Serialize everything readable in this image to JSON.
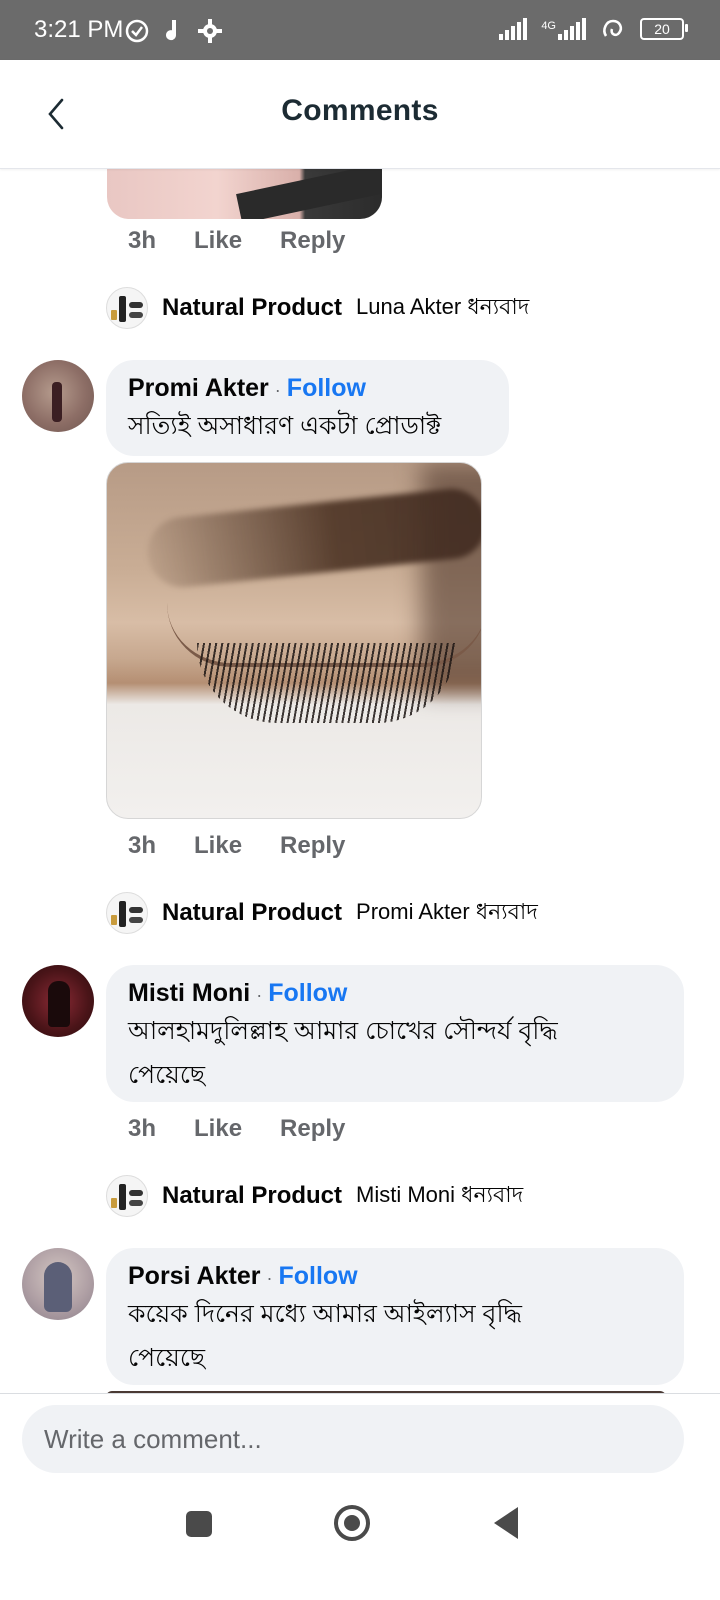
{
  "status_bar": {
    "time": "3:21 PM",
    "network_label": "4G",
    "battery": "20"
  },
  "header": {
    "title": "Comments"
  },
  "comments": [
    {
      "meta": {
        "time": "3h",
        "like": "Like",
        "reply": "Reply"
      },
      "page_reply": {
        "name": "Natural Product",
        "text": "Luna Akter ধন্যবাদ"
      }
    },
    {
      "author": "Promi Akter",
      "follow": "Follow",
      "text": "সত্যিই অসাধারণ একটা প্রোডাক্ট",
      "meta": {
        "time": "3h",
        "like": "Like",
        "reply": "Reply"
      },
      "page_reply": {
        "name": "Natural Product",
        "text": "Promi Akter ধন্যবাদ"
      }
    },
    {
      "author": "Misti Moni",
      "follow": "Follow",
      "text_line1": "আলহামদুলিল্লাহ আমার চোখের সৌন্দর্য বৃদ্ধি",
      "text_line2": "পেয়েছে",
      "meta": {
        "time": "3h",
        "like": "Like",
        "reply": "Reply"
      },
      "page_reply": {
        "name": "Natural Product",
        "text": "Misti Moni ধন্যবাদ"
      }
    },
    {
      "author": "Porsi Akter",
      "follow": "Follow",
      "text_line1": "কয়েক দিনের মধ্যে আমার আইল্যাস বৃদ্ধি",
      "text_line2": "পেয়েছে"
    }
  ],
  "composer": {
    "placeholder": "Write a comment..."
  }
}
